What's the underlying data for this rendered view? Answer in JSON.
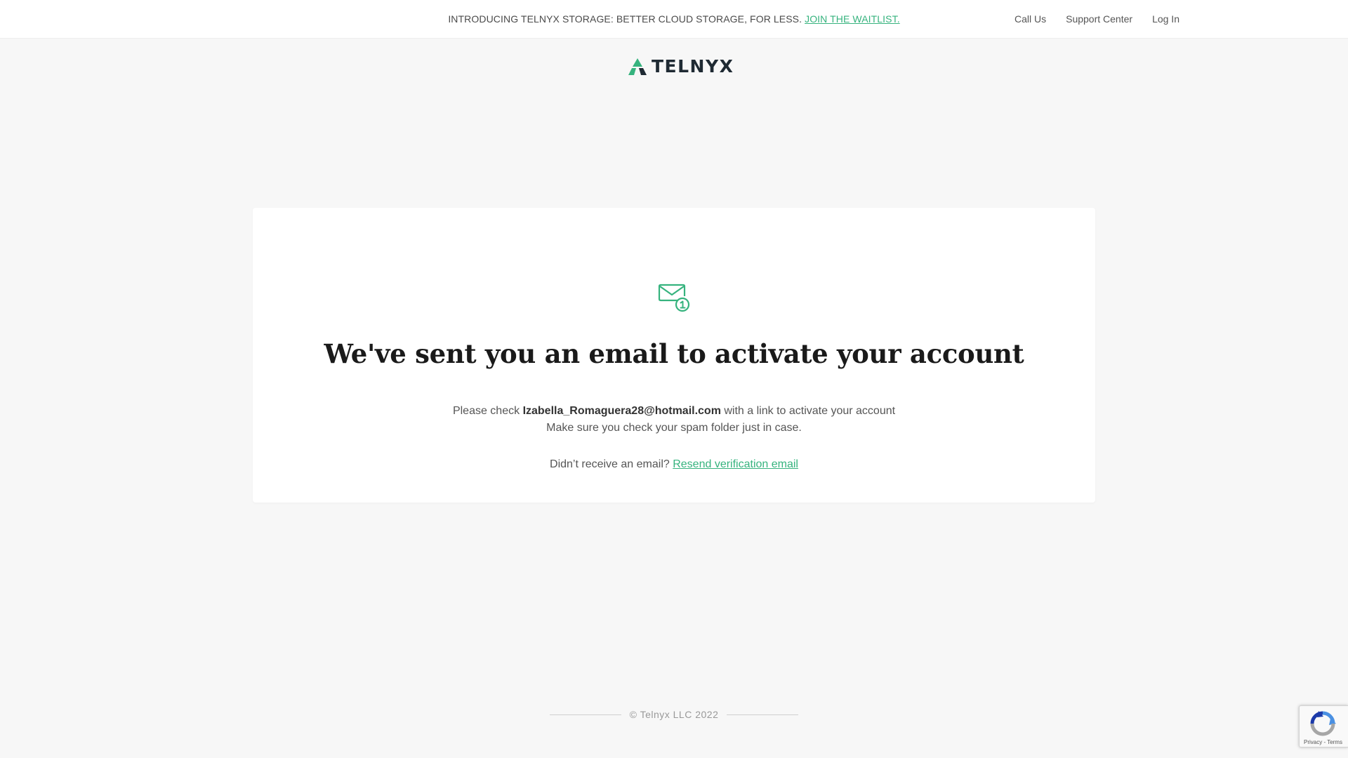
{
  "topbar": {
    "announcement_text": "INTRODUCING TELNYX STORAGE: BETTER CLOUD STORAGE, FOR LESS.",
    "announcement_cta": "JOIN THE WAITLIST.",
    "nav": {
      "call_us": "Call Us",
      "support_center": "Support Center",
      "log_in": "Log In"
    }
  },
  "brand": {
    "name": "TELNYX",
    "logo_icon": "telnyx-logo-icon",
    "accent_color": "#36b37e"
  },
  "main": {
    "icon": "mail-notification-icon",
    "heading": "We've sent you an email to activate your account",
    "check_prefix": "Please check",
    "email": "Izabella_Romaguera28@hotmail.com",
    "check_suffix": "with a link to activate your account",
    "spam_notice": "Make sure you check your spam folder just in case.",
    "resend_prompt": "Didn’t receive an email?",
    "resend_link": "Resend verification email"
  },
  "footer": {
    "copyright": "© Telnyx LLC 2022"
  },
  "recaptcha": {
    "icon": "recaptcha-icon",
    "links": "Privacy - Terms"
  }
}
